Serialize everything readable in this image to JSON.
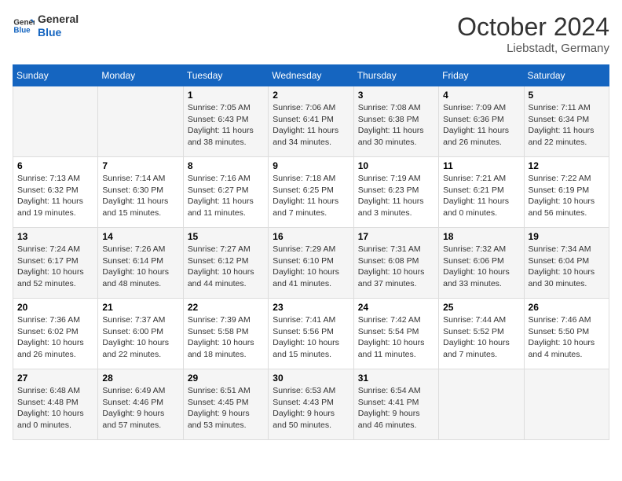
{
  "logo": {
    "line1": "General",
    "line2": "Blue"
  },
  "header": {
    "month": "October 2024",
    "location": "Liebstadt, Germany"
  },
  "days_of_week": [
    "Sunday",
    "Monday",
    "Tuesday",
    "Wednesday",
    "Thursday",
    "Friday",
    "Saturday"
  ],
  "weeks": [
    [
      {
        "day": "",
        "sunrise": "",
        "sunset": "",
        "daylight": ""
      },
      {
        "day": "",
        "sunrise": "",
        "sunset": "",
        "daylight": ""
      },
      {
        "day": "1",
        "sunrise": "Sunrise: 7:05 AM",
        "sunset": "Sunset: 6:43 PM",
        "daylight": "Daylight: 11 hours and 38 minutes."
      },
      {
        "day": "2",
        "sunrise": "Sunrise: 7:06 AM",
        "sunset": "Sunset: 6:41 PM",
        "daylight": "Daylight: 11 hours and 34 minutes."
      },
      {
        "day": "3",
        "sunrise": "Sunrise: 7:08 AM",
        "sunset": "Sunset: 6:38 PM",
        "daylight": "Daylight: 11 hours and 30 minutes."
      },
      {
        "day": "4",
        "sunrise": "Sunrise: 7:09 AM",
        "sunset": "Sunset: 6:36 PM",
        "daylight": "Daylight: 11 hours and 26 minutes."
      },
      {
        "day": "5",
        "sunrise": "Sunrise: 7:11 AM",
        "sunset": "Sunset: 6:34 PM",
        "daylight": "Daylight: 11 hours and 22 minutes."
      }
    ],
    [
      {
        "day": "6",
        "sunrise": "Sunrise: 7:13 AM",
        "sunset": "Sunset: 6:32 PM",
        "daylight": "Daylight: 11 hours and 19 minutes."
      },
      {
        "day": "7",
        "sunrise": "Sunrise: 7:14 AM",
        "sunset": "Sunset: 6:30 PM",
        "daylight": "Daylight: 11 hours and 15 minutes."
      },
      {
        "day": "8",
        "sunrise": "Sunrise: 7:16 AM",
        "sunset": "Sunset: 6:27 PM",
        "daylight": "Daylight: 11 hours and 11 minutes."
      },
      {
        "day": "9",
        "sunrise": "Sunrise: 7:18 AM",
        "sunset": "Sunset: 6:25 PM",
        "daylight": "Daylight: 11 hours and 7 minutes."
      },
      {
        "day": "10",
        "sunrise": "Sunrise: 7:19 AM",
        "sunset": "Sunset: 6:23 PM",
        "daylight": "Daylight: 11 hours and 3 minutes."
      },
      {
        "day": "11",
        "sunrise": "Sunrise: 7:21 AM",
        "sunset": "Sunset: 6:21 PM",
        "daylight": "Daylight: 11 hours and 0 minutes."
      },
      {
        "day": "12",
        "sunrise": "Sunrise: 7:22 AM",
        "sunset": "Sunset: 6:19 PM",
        "daylight": "Daylight: 10 hours and 56 minutes."
      }
    ],
    [
      {
        "day": "13",
        "sunrise": "Sunrise: 7:24 AM",
        "sunset": "Sunset: 6:17 PM",
        "daylight": "Daylight: 10 hours and 52 minutes."
      },
      {
        "day": "14",
        "sunrise": "Sunrise: 7:26 AM",
        "sunset": "Sunset: 6:14 PM",
        "daylight": "Daylight: 10 hours and 48 minutes."
      },
      {
        "day": "15",
        "sunrise": "Sunrise: 7:27 AM",
        "sunset": "Sunset: 6:12 PM",
        "daylight": "Daylight: 10 hours and 44 minutes."
      },
      {
        "day": "16",
        "sunrise": "Sunrise: 7:29 AM",
        "sunset": "Sunset: 6:10 PM",
        "daylight": "Daylight: 10 hours and 41 minutes."
      },
      {
        "day": "17",
        "sunrise": "Sunrise: 7:31 AM",
        "sunset": "Sunset: 6:08 PM",
        "daylight": "Daylight: 10 hours and 37 minutes."
      },
      {
        "day": "18",
        "sunrise": "Sunrise: 7:32 AM",
        "sunset": "Sunset: 6:06 PM",
        "daylight": "Daylight: 10 hours and 33 minutes."
      },
      {
        "day": "19",
        "sunrise": "Sunrise: 7:34 AM",
        "sunset": "Sunset: 6:04 PM",
        "daylight": "Daylight: 10 hours and 30 minutes."
      }
    ],
    [
      {
        "day": "20",
        "sunrise": "Sunrise: 7:36 AM",
        "sunset": "Sunset: 6:02 PM",
        "daylight": "Daylight: 10 hours and 26 minutes."
      },
      {
        "day": "21",
        "sunrise": "Sunrise: 7:37 AM",
        "sunset": "Sunset: 6:00 PM",
        "daylight": "Daylight: 10 hours and 22 minutes."
      },
      {
        "day": "22",
        "sunrise": "Sunrise: 7:39 AM",
        "sunset": "Sunset: 5:58 PM",
        "daylight": "Daylight: 10 hours and 18 minutes."
      },
      {
        "day": "23",
        "sunrise": "Sunrise: 7:41 AM",
        "sunset": "Sunset: 5:56 PM",
        "daylight": "Daylight: 10 hours and 15 minutes."
      },
      {
        "day": "24",
        "sunrise": "Sunrise: 7:42 AM",
        "sunset": "Sunset: 5:54 PM",
        "daylight": "Daylight: 10 hours and 11 minutes."
      },
      {
        "day": "25",
        "sunrise": "Sunrise: 7:44 AM",
        "sunset": "Sunset: 5:52 PM",
        "daylight": "Daylight: 10 hours and 7 minutes."
      },
      {
        "day": "26",
        "sunrise": "Sunrise: 7:46 AM",
        "sunset": "Sunset: 5:50 PM",
        "daylight": "Daylight: 10 hours and 4 minutes."
      }
    ],
    [
      {
        "day": "27",
        "sunrise": "Sunrise: 6:48 AM",
        "sunset": "Sunset: 4:48 PM",
        "daylight": "Daylight: 10 hours and 0 minutes."
      },
      {
        "day": "28",
        "sunrise": "Sunrise: 6:49 AM",
        "sunset": "Sunset: 4:46 PM",
        "daylight": "Daylight: 9 hours and 57 minutes."
      },
      {
        "day": "29",
        "sunrise": "Sunrise: 6:51 AM",
        "sunset": "Sunset: 4:45 PM",
        "daylight": "Daylight: 9 hours and 53 minutes."
      },
      {
        "day": "30",
        "sunrise": "Sunrise: 6:53 AM",
        "sunset": "Sunset: 4:43 PM",
        "daylight": "Daylight: 9 hours and 50 minutes."
      },
      {
        "day": "31",
        "sunrise": "Sunrise: 6:54 AM",
        "sunset": "Sunset: 4:41 PM",
        "daylight": "Daylight: 9 hours and 46 minutes."
      },
      {
        "day": "",
        "sunrise": "",
        "sunset": "",
        "daylight": ""
      },
      {
        "day": "",
        "sunrise": "",
        "sunset": "",
        "daylight": ""
      }
    ]
  ]
}
